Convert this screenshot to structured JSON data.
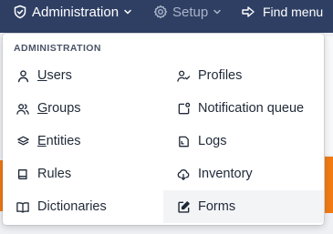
{
  "topbar": {
    "administration_label": "Administration",
    "setup_label": "Setup",
    "find_menu_label": "Find menu"
  },
  "menu": {
    "header": "ADMINISTRATION",
    "left": [
      {
        "first": "U",
        "rest": "sers",
        "icon": "user-icon"
      },
      {
        "first": "G",
        "rest": "roups",
        "icon": "users-icon"
      },
      {
        "first": "E",
        "rest": "ntities",
        "icon": "layers-icon"
      },
      {
        "first": "",
        "rest": "Rules",
        "icon": "book-icon"
      },
      {
        "first": "",
        "rest": "Dictionaries",
        "icon": "open-book-icon"
      }
    ],
    "right": [
      {
        "label": "Profiles",
        "icon": "user-check-icon"
      },
      {
        "label": "Notification queue",
        "icon": "notification-icon"
      },
      {
        "label": "Logs",
        "icon": "log-icon"
      },
      {
        "label": "Inventory",
        "icon": "cloud-download-icon"
      },
      {
        "label": "Forms",
        "icon": "edit-icon"
      }
    ]
  },
  "colors": {
    "topbar": "#2f3f64",
    "accent_orange": "#f07a14",
    "hover_bg": "#f3f4f6"
  }
}
